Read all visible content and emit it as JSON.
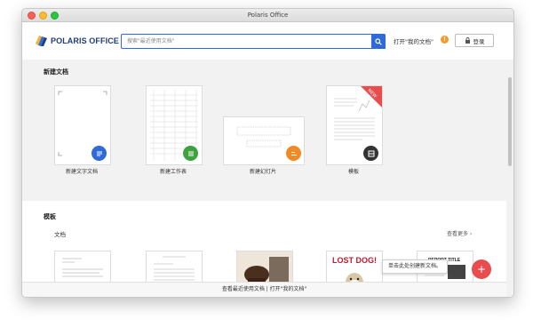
{
  "window": {
    "title": "Polaris Office"
  },
  "header": {
    "logo_text": "POLARIS OFFICE",
    "search_placeholder": "搜索\"最近使用文档\"",
    "open_mydocs": "打开\"我的文档\"",
    "alert_symbol": "!",
    "login_label": "登录"
  },
  "new_docs": {
    "title": "新建文档",
    "items": [
      {
        "label": "新建文字文档",
        "icon": "doc-icon",
        "color": "#2f6ad8"
      },
      {
        "label": "新建工作表",
        "icon": "sheet-icon",
        "color": "#3ea33e"
      },
      {
        "label": "新建幻灯片",
        "icon": "slide-icon",
        "color": "#f08a24"
      },
      {
        "label": "模板",
        "icon": "template-icon",
        "color": "#333333",
        "badge": "NEW"
      }
    ]
  },
  "templates": {
    "title": "模板",
    "subsection": "文档",
    "see_more": "查看更多 ›",
    "thumb_texts": {
      "lost_dog": "LOST DOG!",
      "report_title": "REPORT TITLE"
    }
  },
  "bottom_bar": {
    "text": "查看最近使用文档 | 打开\"我的文档\""
  },
  "tooltip": {
    "text": "单击此处创建新文档。"
  },
  "fab": {
    "symbol": "+"
  }
}
